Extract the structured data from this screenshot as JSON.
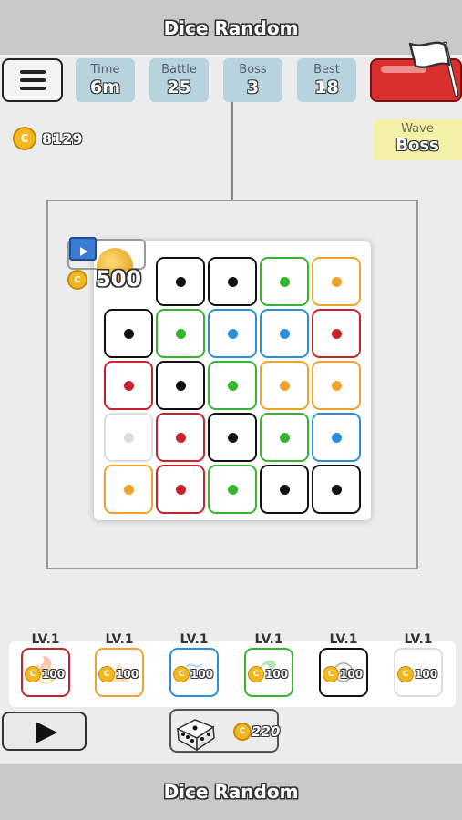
{
  "app_title": "Dice Random",
  "footer_title": "Dice Random",
  "stats": [
    {
      "label": "Time",
      "value": "6m"
    },
    {
      "label": "Battle",
      "value": "25"
    },
    {
      "label": "Boss",
      "value": "3"
    },
    {
      "label": "Best",
      "value": "18"
    }
  ],
  "coin_symbol": "C",
  "coins": "8129",
  "wave": {
    "label": "Wave",
    "value": "Boss"
  },
  "ad_reward": "500",
  "colors": {
    "black": "#111111",
    "green": "#35b52e",
    "blue": "#2a8fd8",
    "red": "#c8232c",
    "orange": "#f0a22e",
    "white": "#dddddd"
  },
  "dice_grid": [
    [
      "none",
      "black",
      "black",
      "green",
      "orange"
    ],
    [
      "black",
      "green",
      "blue",
      "blue",
      "red"
    ],
    [
      "red",
      "black",
      "green",
      "orange",
      "orange"
    ],
    [
      "white",
      "red",
      "black",
      "green",
      "blue"
    ],
    [
      "orange",
      "red",
      "green",
      "black",
      "black"
    ]
  ],
  "upgrades": [
    {
      "level": "LV.1",
      "cost": "100",
      "color": "red",
      "icon": "flame-icon"
    },
    {
      "level": "LV.1",
      "cost": "100",
      "color": "orange",
      "icon": "bomb-icon"
    },
    {
      "level": "LV.1",
      "cost": "100",
      "color": "blue",
      "icon": "wind-icon"
    },
    {
      "level": "LV.1",
      "cost": "100",
      "color": "green",
      "icon": "poison-bottle-icon"
    },
    {
      "level": "LV.1",
      "cost": "100",
      "color": "black",
      "icon": "shield-icon"
    },
    {
      "level": "LV.1",
      "cost": "100",
      "color": "white",
      "icon": "sword-icon"
    }
  ],
  "spawn_cost": "220"
}
